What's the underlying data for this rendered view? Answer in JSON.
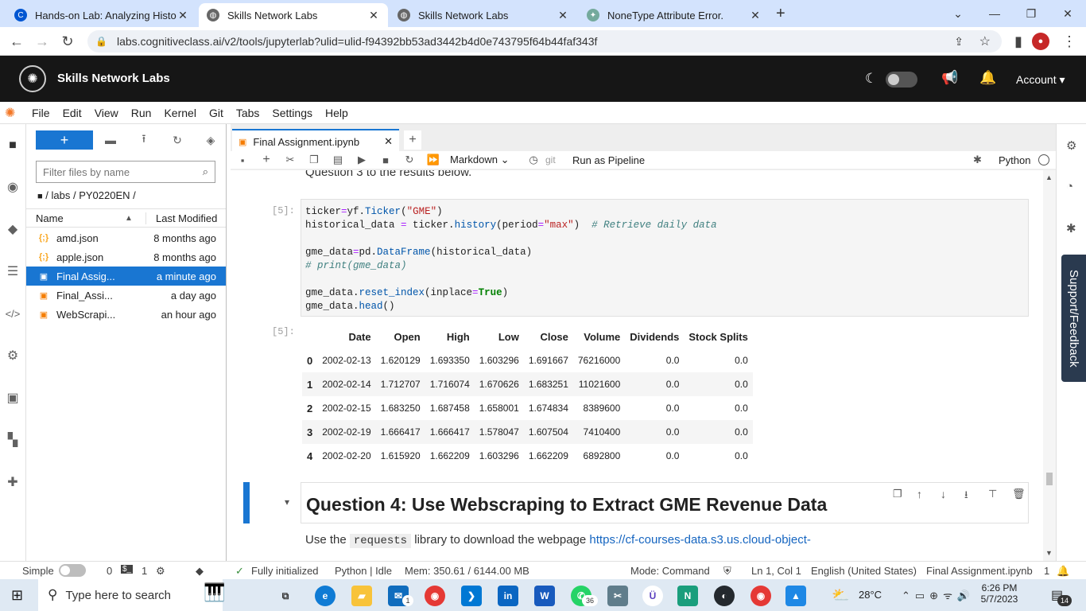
{
  "browser": {
    "tabs": [
      {
        "title": "Hands-on Lab: Analyzing Historic",
        "icon": "coursera-icon",
        "active": false
      },
      {
        "title": "Skills Network Labs",
        "icon": "globe-icon",
        "active": true
      },
      {
        "title": "Skills Network Labs",
        "icon": "globe-icon",
        "active": false
      },
      {
        "title": "NoneType Attribute Error.",
        "icon": "chatgpt-icon",
        "active": false
      }
    ],
    "url": "labs.cognitiveclass.ai/v2/tools/jupyterlab?ulid=ulid-f94392bb53ad3442b4d0e743795f64b44faf343f"
  },
  "header": {
    "brand": "Skills Network Labs",
    "account_label": "Account"
  },
  "menu": [
    "File",
    "Edit",
    "View",
    "Run",
    "Kernel",
    "Git",
    "Tabs",
    "Settings",
    "Help"
  ],
  "filebrowser": {
    "filter_placeholder": "Filter files by name",
    "breadcrumb": "/ labs / PY0220EN /",
    "col_name": "Name",
    "col_modified": "Last Modified",
    "files": [
      {
        "name": "amd.json",
        "modified": "8 months ago",
        "type": "json",
        "selected": false
      },
      {
        "name": "apple.json",
        "modified": "8 months ago",
        "type": "json",
        "selected": false
      },
      {
        "name": "Final Assig...",
        "modified": "a minute ago",
        "type": "notebook",
        "selected": true
      },
      {
        "name": "Final_Assi...",
        "modified": "a day ago",
        "type": "notebook",
        "selected": false
      },
      {
        "name": "WebScrapi...",
        "modified": "an hour ago",
        "type": "notebook",
        "selected": false
      }
    ]
  },
  "notebook": {
    "tab_title": "Final Assignment.ipynb",
    "cell_type": "Markdown",
    "git_label": "git",
    "pipeline_label": "Run as Pipeline",
    "kernel": "Python",
    "prev_text": "Question 3 to the results below.",
    "in_prompt": "[5]:",
    "out_prompt": "[5]:",
    "table": {
      "columns": [
        "",
        "Date",
        "Open",
        "High",
        "Low",
        "Close",
        "Volume",
        "Dividends",
        "Stock Splits"
      ],
      "rows": [
        [
          "0",
          "2002-02-13",
          "1.620129",
          "1.693350",
          "1.603296",
          "1.691667",
          "76216000",
          "0.0",
          "0.0"
        ],
        [
          "1",
          "2002-02-14",
          "1.712707",
          "1.716074",
          "1.670626",
          "1.683251",
          "11021600",
          "0.0",
          "0.0"
        ],
        [
          "2",
          "2002-02-15",
          "1.683250",
          "1.687458",
          "1.658001",
          "1.674834",
          "8389600",
          "0.0",
          "0.0"
        ],
        [
          "3",
          "2002-02-19",
          "1.666417",
          "1.666417",
          "1.578047",
          "1.607504",
          "7410400",
          "0.0",
          "0.0"
        ],
        [
          "4",
          "2002-02-20",
          "1.615920",
          "1.662209",
          "1.603296",
          "1.662209",
          "6892800",
          "0.0",
          "0.0"
        ]
      ]
    },
    "q4_heading": "Question 4: Use Webscraping to Extract GME Revenue Data",
    "q4_text_pre": "Use the",
    "q4_code": "requests",
    "q4_text_mid": "library to download the webpage",
    "q4_link": "https://cf-courses-data.s3.us.cloud-object-"
  },
  "support_label": "Support/Feedback",
  "status": {
    "mode_simple": "Simple",
    "terminals": "0",
    "kernels": "1",
    "init": "Fully initialized",
    "kernel_state": "Python | Idle",
    "mem": "Mem: 350.61 / 6144.00 MB",
    "mode": "Mode: Command",
    "pos": "Ln 1, Col 1",
    "lang": "English (United States)",
    "file": "Final Assignment.ipynb",
    "count": "1"
  },
  "taskbar": {
    "search_placeholder": "Type here to search",
    "temperature": "28°C",
    "time": "6:26 PM",
    "date": "5/7/2023",
    "notif_count": "14",
    "mail_badge": "1",
    "whatsapp_badge": "36"
  },
  "colors": {
    "accent": "#1976d2",
    "header_bg": "#161616",
    "tab_bar": "#d3e3fd"
  }
}
